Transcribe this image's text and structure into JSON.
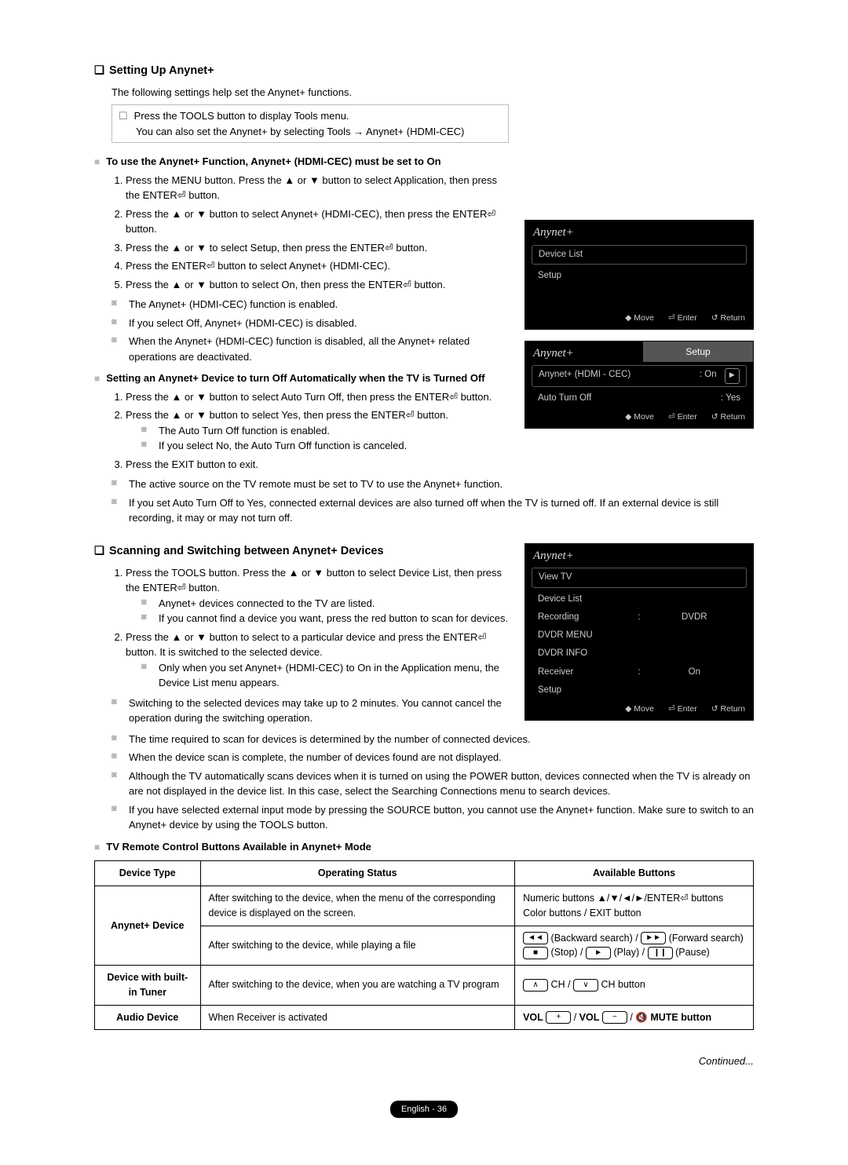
{
  "sec1": {
    "title": "Setting Up Anynet+",
    "intro": "The following settings help set the Anynet+ functions.",
    "tool_l1": "Press the TOOLS button to display Tools menu.",
    "tool_l2": "You can also set the Anynet+ by selecting Tools → Anynet+ (HDMI-CEC)",
    "subA": "To use the Anynet+ Function, Anynet+ (HDMI-CEC) must be set to On",
    "stepsA": [
      "Press the MENU button. Press the ▲ or ▼ button to select Application, then press the ENTER⏎ button.",
      "Press the ▲ or ▼ button to select Anynet+ (HDMI-CEC), then press the ENTER⏎ button.",
      "Press the  ▲ or ▼  to select Setup, then press the ENTER⏎ button.",
      "Press the ENTER⏎ button to select Anynet+ (HDMI-CEC).",
      "Press the ▲ or ▼ button to select On, then press the ENTER⏎ button."
    ],
    "notesA": [
      "The Anynet+ (HDMI-CEC) function is enabled.",
      "If you select Off, Anynet+ (HDMI-CEC) is disabled.",
      "When the Anynet+ (HDMI-CEC) function is disabled, all the Anynet+ related operations are deactivated."
    ],
    "subB": "Setting an Anynet+ Device to turn Off Automatically when the TV is Turned Off",
    "stepsB1": "Press the ▲ or ▼ button to select Auto Turn Off, then press the ENTER⏎ button.",
    "stepsB2": "Press the ▲ or ▼ button to select Yes, then press the ENTER⏎ button.",
    "stepsB2n1": "The Auto Turn Off function is enabled.",
    "stepsB2n2": "If you select No, the Auto Turn Off function is canceled.",
    "stepsB3": "Press the EXIT button to exit.",
    "notesB": [
      "The active source on the TV remote must be set to TV to use the Anynet+ function.",
      "If you set Auto Turn Off to Yes, connected external devices are also turned off when the TV is turned off. If an external device is still recording, it may or may not turn off."
    ]
  },
  "osd1": {
    "brand": "Anynet+",
    "r1": "Device List",
    "r2": "Setup",
    "foot_move": "◆ Move",
    "foot_enter": "⏎ Enter",
    "foot_return": "↺ Return"
  },
  "osd2": {
    "brand": "Anynet+",
    "title": "Setup",
    "r1k": "Anynet+ (HDMI - CEC)",
    "r1v": ": On",
    "r2k": "Auto Turn Off",
    "r2v": ": Yes",
    "foot_move": "◆ Move",
    "foot_enter": "⏎ Enter",
    "foot_return": "↺ Return",
    "arrow": "►"
  },
  "sec2": {
    "title": "Scanning and Switching between Anynet+ Devices",
    "step1": "Press the TOOLS button. Press the ▲ or ▼ button to select Device List, then press the ENTER⏎ button.",
    "step1n1": "Anynet+ devices connected to the TV are listed.",
    "step1n2": "If you cannot find a device you want, press the red button to scan for devices.",
    "step2": "Press the ▲ or ▼ button to select to a particular device and press the ENTER⏎ button. It is switched to the selected device.",
    "step2n1": "Only when you set Anynet+ (HDMI-CEC) to On in the Application menu, the Device List menu appears.",
    "notes": [
      "Switching to the selected devices may take up to 2 minutes. You cannot cancel the operation during the switching operation.",
      "The time required to scan for devices is determined by the number of connected devices.",
      "When the device scan is complete, the number of devices found are not displayed.",
      "Although the TV automatically scans devices when it is turned on using the POWER button, devices connected when the TV is already on are not displayed in the device list. In this case, select the Searching Connections menu to search devices.",
      "If you have selected external input mode by pressing the SOURCE button, you cannot use the Anynet+ function. Make sure to switch to an Anynet+ device by using the TOOLS button."
    ]
  },
  "osd3": {
    "brand": "Anynet+",
    "rows": [
      {
        "k": "View TV",
        "v": ""
      },
      {
        "k": "Device List",
        "v": ""
      },
      {
        "k": "Recording",
        "v": "DVDR",
        "sep": ":"
      },
      {
        "k": "DVDR MENU",
        "v": ""
      },
      {
        "k": "DVDR INFO",
        "v": ""
      },
      {
        "k": "Receiver",
        "v": "On",
        "sep": ":"
      },
      {
        "k": "Setup",
        "v": ""
      }
    ],
    "foot_move": "◆ Move",
    "foot_enter": "⏎ Enter",
    "foot_return": "↺ Return"
  },
  "table": {
    "title": "TV Remote Control Buttons Available in Anynet+ Mode",
    "h1": "Device Type",
    "h2": "Operating Status",
    "h3": "Available Buttons",
    "r1d": "Anynet+ Device",
    "r1o": "After switching to the device, when the menu of the corresponding device is displayed on the screen.",
    "r1a": "Numeric buttons ▲/▼/◄/►/ENTER⏎ buttons Color buttons / EXIT button",
    "r2o": "After switching to the device, while playing a file",
    "r2a_bwd": "(Backward search) /",
    "r2a_fwd": "(Forward search)",
    "r2a_stop": "(Stop) /",
    "r2a_play": "(Play) /",
    "r2a_pause": "(Pause)",
    "r3d": "Device with built-in Tuner",
    "r3o": "After switching to the device, when you are watching a TV program",
    "r3a": "CH button",
    "r4d": "Audio Device",
    "r4o": "When Receiver is activated",
    "r4a_vol": "VOL",
    "r4a_mute": "MUTE button"
  },
  "continued": "Continued...",
  "page_foot": "English - 36"
}
